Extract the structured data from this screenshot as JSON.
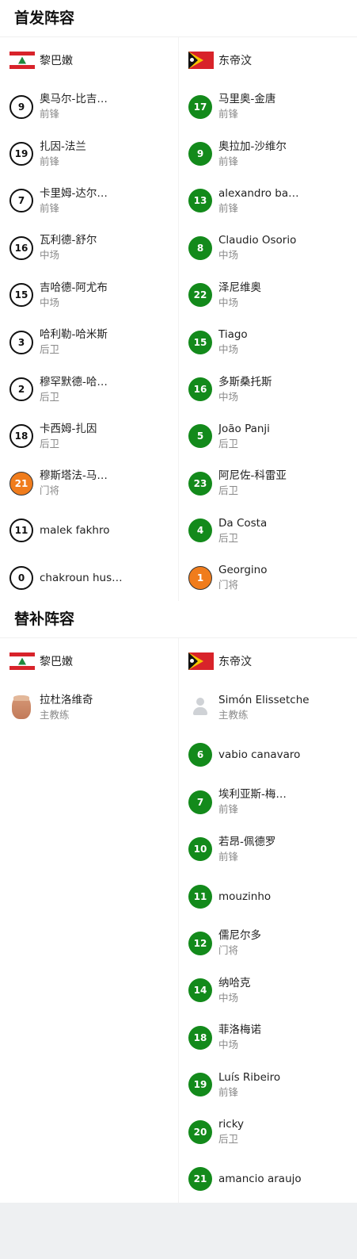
{
  "starting": {
    "title": "首发阵容",
    "home": {
      "team_name": "黎巴嫩",
      "players": [
        {
          "number": "9",
          "name": "奥马尔-比吉…",
          "position": "前锋",
          "style": "outline"
        },
        {
          "number": "19",
          "name": "扎因-法兰",
          "position": "前锋",
          "style": "outline"
        },
        {
          "number": "7",
          "name": "卡里姆-达尔…",
          "position": "前锋",
          "style": "outline"
        },
        {
          "number": "16",
          "name": "瓦利德-舒尔",
          "position": "中场",
          "style": "outline"
        },
        {
          "number": "15",
          "name": "吉哈德-阿尤布",
          "position": "中场",
          "style": "outline"
        },
        {
          "number": "3",
          "name": "哈利勒-哈米斯",
          "position": "后卫",
          "style": "outline"
        },
        {
          "number": "2",
          "name": "穆罕默德-哈…",
          "position": "后卫",
          "style": "outline"
        },
        {
          "number": "18",
          "name": "卡西姆-扎因",
          "position": "后卫",
          "style": "outline"
        },
        {
          "number": "21",
          "name": "穆斯塔法-马…",
          "position": "门将",
          "style": "orange"
        },
        {
          "number": "11",
          "name": "malek fakhro",
          "position": "",
          "style": "outline"
        },
        {
          "number": "0",
          "name": "chakroun hus…",
          "position": "",
          "style": "outline"
        }
      ]
    },
    "away": {
      "team_name": "东帝汶",
      "players": [
        {
          "number": "17",
          "name": "马里奥-金唐",
          "position": "前锋",
          "style": "green"
        },
        {
          "number": "9",
          "name": "奥拉加-沙维尔",
          "position": "前锋",
          "style": "green"
        },
        {
          "number": "13",
          "name": "alexandro ba…",
          "position": "前锋",
          "style": "green"
        },
        {
          "number": "8",
          "name": "Claudio Osorio",
          "position": "中场",
          "style": "green"
        },
        {
          "number": "22",
          "name": "泽尼维奥",
          "position": "中场",
          "style": "green"
        },
        {
          "number": "15",
          "name": "Tiago",
          "position": "中场",
          "style": "green"
        },
        {
          "number": "16",
          "name": "多斯桑托斯",
          "position": "中场",
          "style": "green"
        },
        {
          "number": "5",
          "name": "João Panji",
          "position": "后卫",
          "style": "green"
        },
        {
          "number": "23",
          "name": "阿尼佐-科雷亚",
          "position": "后卫",
          "style": "green"
        },
        {
          "number": "4",
          "name": "Da Costa",
          "position": "后卫",
          "style": "green"
        },
        {
          "number": "1",
          "name": "Georgino",
          "position": "门将",
          "style": "orange"
        }
      ]
    }
  },
  "subs": {
    "title": "替补阵容",
    "home": {
      "team_name": "黎巴嫩",
      "coach": {
        "name": "拉杜洛维奇",
        "role": "主教练"
      },
      "players": []
    },
    "away": {
      "team_name": "东帝汶",
      "coach": {
        "name": "Simón Elissetche",
        "role": "主教练"
      },
      "players": [
        {
          "number": "6",
          "name": "vabio canavaro",
          "position": "",
          "style": "green"
        },
        {
          "number": "7",
          "name": "埃利亚斯-梅…",
          "position": "前锋",
          "style": "green"
        },
        {
          "number": "10",
          "name": "若昂-佩德罗",
          "position": "前锋",
          "style": "green"
        },
        {
          "number": "11",
          "name": "mouzinho",
          "position": "",
          "style": "green"
        },
        {
          "number": "12",
          "name": "儒尼尔多",
          "position": "门将",
          "style": "green"
        },
        {
          "number": "14",
          "name": "纳哈克",
          "position": "中场",
          "style": "green"
        },
        {
          "number": "18",
          "name": "菲洛梅诺",
          "position": "中场",
          "style": "green"
        },
        {
          "number": "19",
          "name": "Luís Ribeiro",
          "position": "前锋",
          "style": "green"
        },
        {
          "number": "20",
          "name": "ricky",
          "position": "后卫",
          "style": "green"
        },
        {
          "number": "21",
          "name": "amancio araujo",
          "position": "",
          "style": "green"
        }
      ]
    }
  },
  "colors": {
    "accent_green": "#138a1b",
    "goalkeeper_orange": "#f07c1c",
    "muted": "#8a8a8a"
  },
  "icons": {
    "home_flag": "lebanon-flag-icon",
    "away_flag": "timor-leste-flag-icon"
  }
}
